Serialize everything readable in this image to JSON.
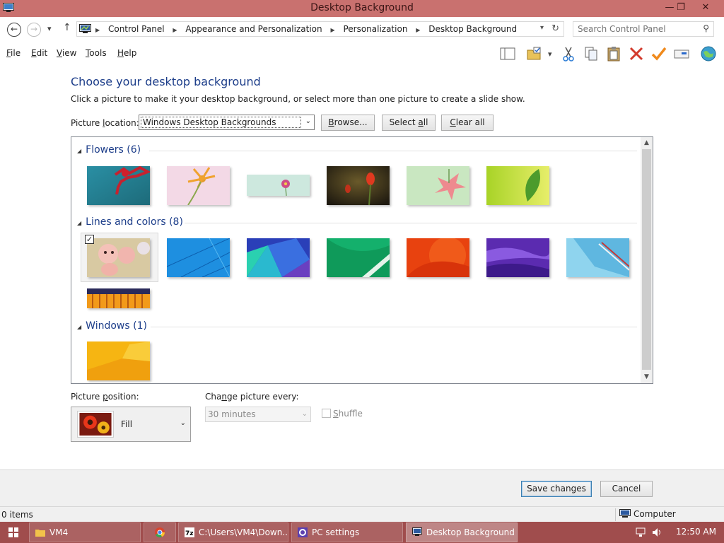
{
  "window": {
    "title": "Desktop Background",
    "controls": {
      "minimize": "—",
      "maximize": "❐",
      "close": "✕"
    }
  },
  "nav": {
    "back": "←",
    "forward": "→",
    "recent": "▾",
    "up": "↑",
    "breadcrumb": [
      "Control Panel",
      "Appearance and Personalization",
      "Personalization",
      "Desktop Background"
    ],
    "refresh": "↻",
    "dropdown": "▾"
  },
  "search": {
    "placeholder": "Search Control Panel",
    "icon": "⚲"
  },
  "menu": {
    "file": {
      "key": "F",
      "rest": "ile"
    },
    "edit": {
      "key": "E",
      "rest": "dit"
    },
    "view": {
      "key": "V",
      "rest": "iew"
    },
    "tools": {
      "key": "T",
      "rest": "ools"
    },
    "help": {
      "key": "H",
      "rest": "elp"
    }
  },
  "main": {
    "heading": "Choose your desktop background",
    "subtext": "Click a picture to make it your desktop background, or select more than one picture to create a slide show.",
    "location_label_pre": "Picture ",
    "location_label_key": "l",
    "location_label_post": "ocation:",
    "location_value": "Windows Desktop Backgrounds",
    "browse": {
      "key": "B",
      "rest": "rowse..."
    },
    "select_all": {
      "pre": "Select ",
      "key": "a",
      "rest": "ll"
    },
    "clear_all": {
      "key": "C",
      "rest": "lear all"
    }
  },
  "gallery": {
    "groups": [
      {
        "label": "Flowers (6)"
      },
      {
        "label": "Lines and colors (8)"
      },
      {
        "label": "Windows (1)"
      }
    ],
    "selected_checkmark": "✓"
  },
  "position": {
    "label_pre": "Picture ",
    "label_key": "p",
    "label_post": "osition:",
    "value": "Fill",
    "arrow": "⌄"
  },
  "interval": {
    "label_pre": "Cha",
    "label_key": "n",
    "label_post": "ge picture every:",
    "value": "30 minutes",
    "arrow": "⌄"
  },
  "shuffle": {
    "key": "S",
    "rest": "huffle"
  },
  "footer": {
    "save": "Save changes",
    "cancel": "Cancel"
  },
  "status": {
    "items": "0 items",
    "location": "Computer"
  },
  "taskbar": {
    "tasks": [
      "VM4",
      "",
      "C:\\Users\\VM4\\Down...",
      "PC settings",
      "Desktop Background"
    ],
    "clock": "12:50 AM"
  },
  "colors": {
    "titlebar": "#c9716f",
    "taskbar": "#a04d4d",
    "heading": "#1d3e8a"
  }
}
